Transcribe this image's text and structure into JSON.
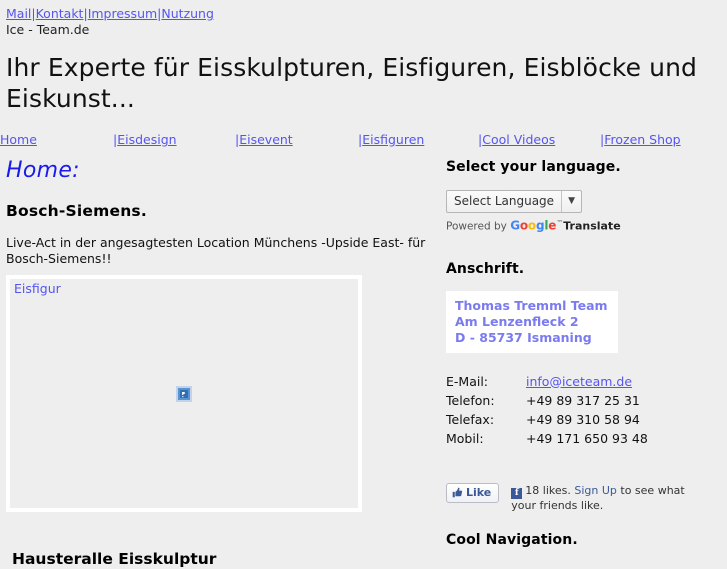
{
  "topbar": {
    "links": [
      "Mail",
      "Kontakt",
      "Impressum",
      "Nutzung"
    ],
    "separator": "|",
    "site_name": "Ice - Team.de"
  },
  "header": {
    "title": "Ihr Experte für Eisskulpturen, Eisfiguren, Eisblöcke und Eiskunst..."
  },
  "nav": {
    "items": [
      {
        "label": "Home",
        "bar": ""
      },
      {
        "label": "Eisdesign",
        "bar": "|"
      },
      {
        "label": "Eisevent",
        "bar": "|"
      },
      {
        "label": "Eisfiguren",
        "bar": "|"
      },
      {
        "label": "Cool Videos",
        "bar": "|"
      },
      {
        "label": "Frozen Shop",
        "bar": "|"
      }
    ]
  },
  "main": {
    "page_heading": "Home:",
    "article_heading": "Bosch-Siemens.",
    "article_text": "Live-Act in der angesagtesten Location Münchens -Upside East- für Bosch-Siemens!!",
    "media_caption": "Eisfigur",
    "bottom_heading": "Hausteralle Eisskulptur"
  },
  "sidebar": {
    "language_heading": "Select your language.",
    "translate": {
      "button_label": "Select Language",
      "arrow": "▼",
      "powered_by": "Powered by",
      "google_letters": [
        "G",
        "o",
        "o",
        "g",
        "l",
        "e"
      ],
      "trademark": "™",
      "translate_word": "Translate"
    },
    "address_heading": "Anschrift.",
    "address_lines": [
      "Thomas Tremml Team",
      "Am Lenzenfleck 2",
      "D - 85737 Ismaning"
    ],
    "contacts": [
      {
        "label": "E-Mail:",
        "value": "info@iceteam.de",
        "is_link": true
      },
      {
        "label": "Telefon:",
        "value": "+49 89 317 25 31",
        "is_link": false
      },
      {
        "label": "Telefax:",
        "value": "+49 89 310 58 94",
        "is_link": false
      },
      {
        "label": "Mobil:",
        "value": "+49 171 650 93 48",
        "is_link": false
      }
    ],
    "facebook": {
      "like_label": "Like",
      "badge_letter": "f",
      "count_text": "18 likes.",
      "signup_label": "Sign Up",
      "tail_text": "to see what your friends like."
    },
    "bottom_heading": "Cool Navigation."
  },
  "colors": {
    "page_bg": "#eeeeee",
    "link": "#5555ee",
    "heading_blue": "#1a1aee",
    "address_text": "#7b7bf0",
    "facebook_blue": "#3b5998",
    "box_border": "#ffffff"
  }
}
